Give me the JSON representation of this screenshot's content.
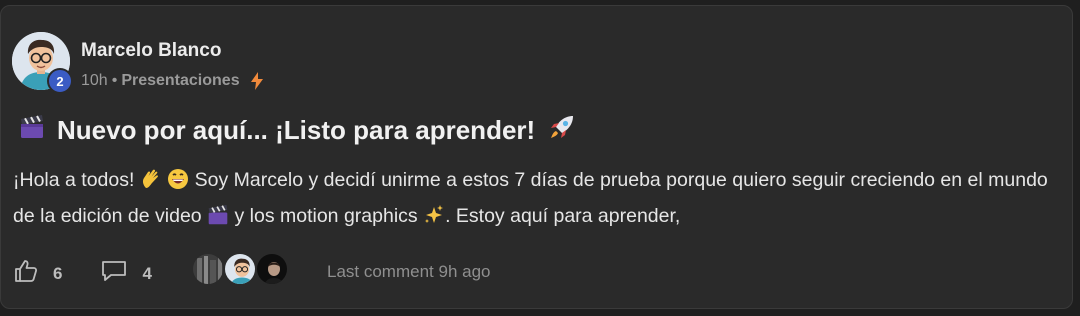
{
  "post": {
    "author": "Marcelo Blanco",
    "level": "2",
    "time": "10h",
    "separator": "•",
    "category": "Presentaciones",
    "title": "Nuevo por aquí... ¡Listo para aprender!",
    "body": {
      "seg1": "¡Hola a todos! ",
      "seg2": " Soy Marcelo y decidí unirme a estos 7 días de prueba porque quiero seguir creciendo en el mundo de la edición de video ",
      "seg3": " y los motion graphics ",
      "seg4": ". Estoy aquí para aprender,"
    },
    "likes": "6",
    "comments": "4",
    "last_comment": "Last comment 9h ago"
  },
  "icons": {
    "title_leading": "clapper-board-icon",
    "title_trailing": "rocket-icon",
    "category_badge": "lightning-bolt-icon",
    "like": "thumbs-up-icon",
    "comment": "comment-bubble-icon"
  },
  "colors": {
    "background": "#1f1f1f",
    "card": "#2a2a2a",
    "level_badge": "#3b5cc4",
    "bolt": "#f08a3c"
  }
}
